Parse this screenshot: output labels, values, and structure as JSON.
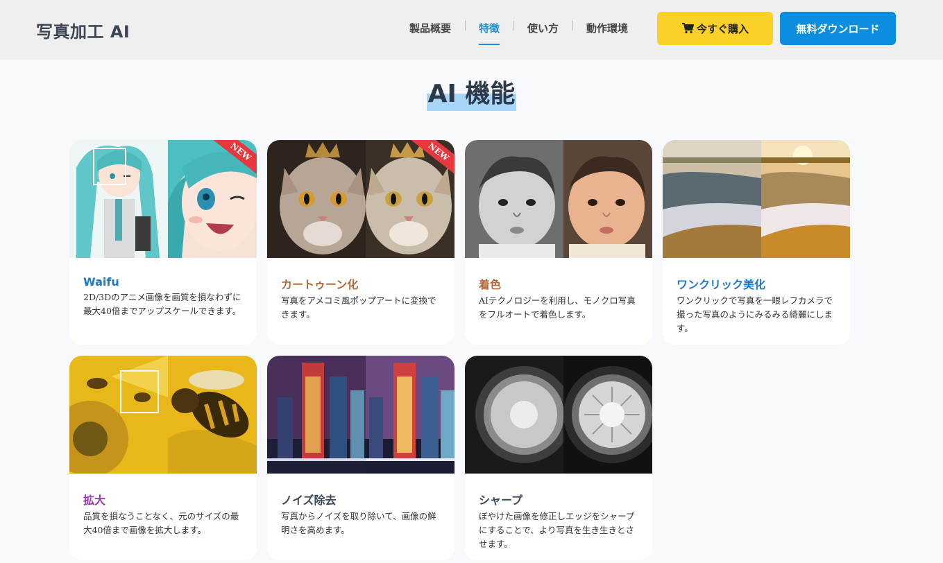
{
  "header": {
    "logo": "写真加工 AI",
    "nav": [
      "製品概要",
      "特徴",
      "使い方",
      "動作環境"
    ],
    "active_nav": "特徴",
    "buy_label": "今すぐ購入",
    "download_label": "無料ダウンロード"
  },
  "section": {
    "title": "AI 機能"
  },
  "cards": [
    {
      "title": "Waifu",
      "desc": "2D/3Dのアニメ画像を画質を損なわずに最大40倍までアップスケールできます。",
      "title_color": "#1f78c8",
      "badge": "NEW"
    },
    {
      "title": "カートゥーン化",
      "desc": "写真をアメコミ風ポップアートに変換できます。",
      "title_color": "#b3683c",
      "badge": "NEW"
    },
    {
      "title": "着色",
      "desc": "AIテクノロジーを利用し、モノクロ写真をフルオートで着色します。",
      "title_color": "#b3683c"
    },
    {
      "title": "ワンクリック美化",
      "desc": "ワンクリックで写真を一眼レフカメラで撮った写真のようにみるみる綺麗にします。",
      "title_color": "#1f78c8"
    },
    {
      "title": "拡大",
      "desc": "品質を損なうことなく、元のサイズの最大40倍まで画像を拡大します。",
      "title_color": "#9b36b7"
    },
    {
      "title": "ノイズ除去",
      "desc": "写真からノイズを取り除いて、画像の鮮明さを高めます。",
      "title_color": "#3b4553"
    },
    {
      "title": "シャープ",
      "desc": "ぼやけた画像を修正しエッジをシャープにすることで、より写真を生き生きとさせます。",
      "title_color": "#3b4553"
    }
  ]
}
